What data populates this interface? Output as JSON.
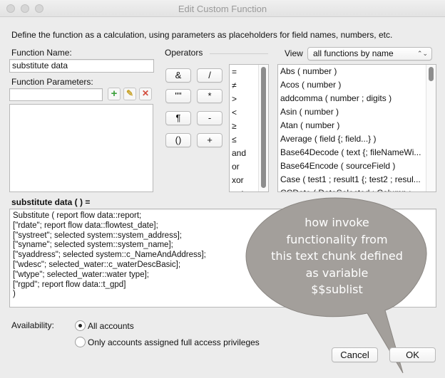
{
  "window": {
    "title": "Edit Custom Function"
  },
  "instructions": "Define the function as a calculation, using parameters as placeholders for field names, numbers, etc.",
  "function_name": {
    "label": "Function Name:",
    "value": "substitute data"
  },
  "function_parameters": {
    "label": "Function Parameters:",
    "value": ""
  },
  "operators": {
    "label": "Operators",
    "buttons": [
      "&",
      "/",
      "\"\"",
      "*",
      "¶",
      "-",
      "()",
      "+"
    ],
    "list": [
      "=",
      "≠",
      ">",
      "<",
      "≥",
      "≤",
      "and",
      "or",
      "xor",
      "not"
    ]
  },
  "view": {
    "label": "View",
    "selected": "all functions by name",
    "functions": [
      "Abs ( number )",
      "Acos ( number )",
      "addcomma ( number ; digits )",
      "Asin ( number )",
      "Atan ( number )",
      "Average ( field {; field...} )",
      "Base64Decode ( text {; fileNameWi...",
      "Base64Encode ( sourceField )",
      "Case ( test1 ; result1 {; test2 ; resul...",
      "CCDate ( DateSelected ; Column ;"
    ]
  },
  "calc": {
    "label": "substitute data (  ) =",
    "lines": [
      "Substitute ( report flow data::report;",
      "[\"rdate\"; report flow data::flowtest_date];",
      "[\"systreet\"; selected system::system_address];",
      "[\"syname\"; selected system::system_name];",
      "[\"syaddress\"; selected system::c_NameAndAddress];",
      "[\"wdesc\"; selected_water::c_waterDescBasic];",
      "[\"wtype\"; selected_water::water type];",
      "[\"rgpd\"; report flow data::t_gpd]",
      ")"
    ]
  },
  "callout": {
    "lines": [
      "how invoke",
      "functionality from",
      "this text chunk defined",
      "as variable",
      "$$sublist"
    ]
  },
  "availability": {
    "label": "Availability:",
    "options": [
      "All accounts",
      "Only accounts assigned full access privileges"
    ],
    "selected_index": 0
  },
  "buttons": {
    "cancel": "Cancel",
    "ok": "OK"
  }
}
